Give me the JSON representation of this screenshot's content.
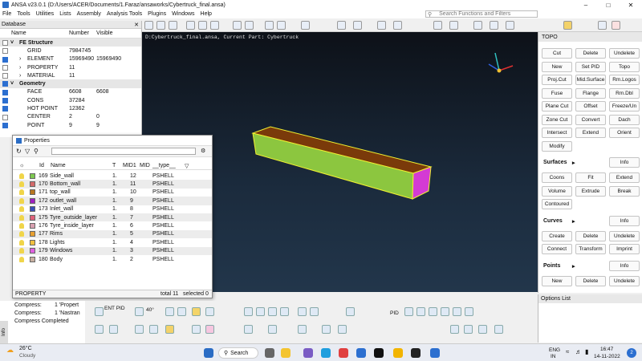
{
  "window": {
    "title": "ANSA v23.0.1 (D:/Users/ACER/Documents/1.Faraz/ansaworks/Cybertruck_final.ansa)"
  },
  "menu": [
    "File",
    "Tools",
    "Utilities",
    "Lists",
    "Assembly",
    "Analysis Tools",
    "Plugins",
    "Windows",
    "Help"
  ],
  "search": {
    "placeholder": "Search Functions and Filters"
  },
  "database": {
    "title": "Database",
    "columns": {
      "name": "Name",
      "number": "Number",
      "visible": "Visible"
    },
    "rows": [
      {
        "type": "section",
        "name": "FE Structure"
      },
      {
        "name": "GRID",
        "number": "7984745",
        "visible": "",
        "checked": false
      },
      {
        "name": "ELEMENT",
        "number": "15969490",
        "visible": "15969490",
        "checked": true
      },
      {
        "name": "PROPERTY",
        "number": "11",
        "visible": "",
        "checked": false
      },
      {
        "name": "MATERIAL",
        "number": "11",
        "visible": "",
        "checked": false
      },
      {
        "type": "section",
        "name": "Geometry"
      },
      {
        "name": "FACE",
        "number": "6608",
        "visible": "6608",
        "checked": true
      },
      {
        "name": "CONS",
        "number": "37284",
        "visible": "",
        "checked": true
      },
      {
        "name": "HOT POINT",
        "number": "12362",
        "visible": "",
        "checked": true
      },
      {
        "name": "CENTER",
        "number": "2",
        "visible": "0",
        "checked": false
      },
      {
        "name": "POINT",
        "number": "9",
        "visible": "9",
        "checked": true
      }
    ]
  },
  "viewport": {
    "info": "D:Cybertruck_final.ansa,  Current Part: Cybertruck"
  },
  "properties": {
    "title": "Properties",
    "columns": {
      "t": "T",
      "id": "Id",
      "name": "Name",
      "t2": "T",
      "mid1": "MID1",
      "mid": "MID",
      "type": "__type__"
    },
    "rows": [
      {
        "id": "169",
        "name": "Side_wall",
        "t": "1.",
        "mid1": "12",
        "type": "PSHELL",
        "color": "#7ec850"
      },
      {
        "id": "170",
        "name": "Bottom_wall",
        "t": "1.",
        "mid1": "11",
        "type": "PSHELL",
        "color": "#d46a6a"
      },
      {
        "id": "171",
        "name": "top_wall",
        "t": "1.",
        "mid1": "10",
        "type": "PSHELL",
        "color": "#b87820"
      },
      {
        "id": "172",
        "name": "outlet_wall",
        "t": "1.",
        "mid1": "9",
        "type": "PSHELL",
        "color": "#a020c0"
      },
      {
        "id": "173",
        "name": "Inlet_wall",
        "t": "1.",
        "mid1": "8",
        "type": "PSHELL",
        "color": "#3a4fb8"
      },
      {
        "id": "175",
        "name": "Tyre_outside_layer",
        "t": "1.",
        "mid1": "7",
        "type": "PSHELL",
        "color": "#e0607a"
      },
      {
        "id": "176",
        "name": "Tyre_inside_layer",
        "t": "1.",
        "mid1": "6",
        "type": "PSHELL",
        "color": "#d8a0b0"
      },
      {
        "id": "177",
        "name": "Rims",
        "t": "1.",
        "mid1": "5",
        "type": "PSHELL",
        "color": "#e8a030"
      },
      {
        "id": "178",
        "name": "Lights",
        "t": "1.",
        "mid1": "4",
        "type": "PSHELL",
        "color": "#f0c040"
      },
      {
        "id": "179",
        "name": "Windows",
        "t": "1.",
        "mid1": "3",
        "type": "PSHELL",
        "color": "#e060e0"
      },
      {
        "id": "180",
        "name": "Body",
        "t": "1.",
        "mid1": "2",
        "type": "PSHELL",
        "color": "#c8b0a0"
      }
    ],
    "status": {
      "label": "PROPERTY",
      "total": "total 11",
      "selected": "selected 0"
    }
  },
  "topo": {
    "title": "TOPO",
    "buttons": [
      [
        "Cut",
        "Delete",
        "Undelete"
      ],
      [
        "New",
        "Set PID",
        "Topo"
      ],
      [
        "Proj.Cut",
        "Mid.Surface",
        "Rm.Logos"
      ],
      [
        "Fuse",
        "Flange",
        "Rm.Dbl"
      ],
      [
        "Plane Cut",
        "Offset",
        "Freeze/Un"
      ],
      [
        "Zone Cut",
        "Convert",
        "Dach"
      ],
      [
        "Intersect",
        "Extend",
        "Orient"
      ],
      [
        "Modify"
      ]
    ],
    "surfaces": {
      "label": "Surfaces",
      "info": "Info",
      "buttons": [
        [
          "Coons",
          "Fit",
          "Extend"
        ],
        [
          "Volume",
          "Extrude",
          "Break"
        ],
        [
          "Contoured"
        ]
      ]
    },
    "curves": {
      "label": "Curves",
      "info": "Info",
      "buttons": [
        [
          "Create",
          "Delete",
          "Undelete"
        ],
        [
          "Connect",
          "Transform",
          "Imprint"
        ]
      ]
    },
    "points": {
      "label": "Points",
      "info": "Info",
      "buttons": [
        [
          "New",
          "Delete",
          "Undelete"
        ]
      ]
    }
  },
  "options_list": {
    "title": "Options List"
  },
  "console": {
    "lines": [
      {
        "label": "Compress:",
        "value": "1 'Propert"
      },
      {
        "label": "Compress:",
        "value": "1 'Nastran"
      },
      {
        "label": "Compress Completed",
        "value": ""
      }
    ],
    "tab": "Info"
  },
  "bottom_toolbar": {
    "ent_pid": "ENT PID",
    "angle": "40°",
    "pid": "PID"
  },
  "taskbar": {
    "weather_temp": "26°C",
    "weather_desc": "Cloudy",
    "search": "Search",
    "lang1": "ENG",
    "lang2": "IN",
    "time": "16:47",
    "date": "14-11-2022",
    "notif": "2"
  },
  "colors": {
    "viewport_bg": "#16222f",
    "accent": "#2c6fd0",
    "beam_top": "#7a3a0a",
    "beam_side": "#8cc63f",
    "beam_end": "#d43ad4",
    "beam_edge": "#f0f030"
  }
}
